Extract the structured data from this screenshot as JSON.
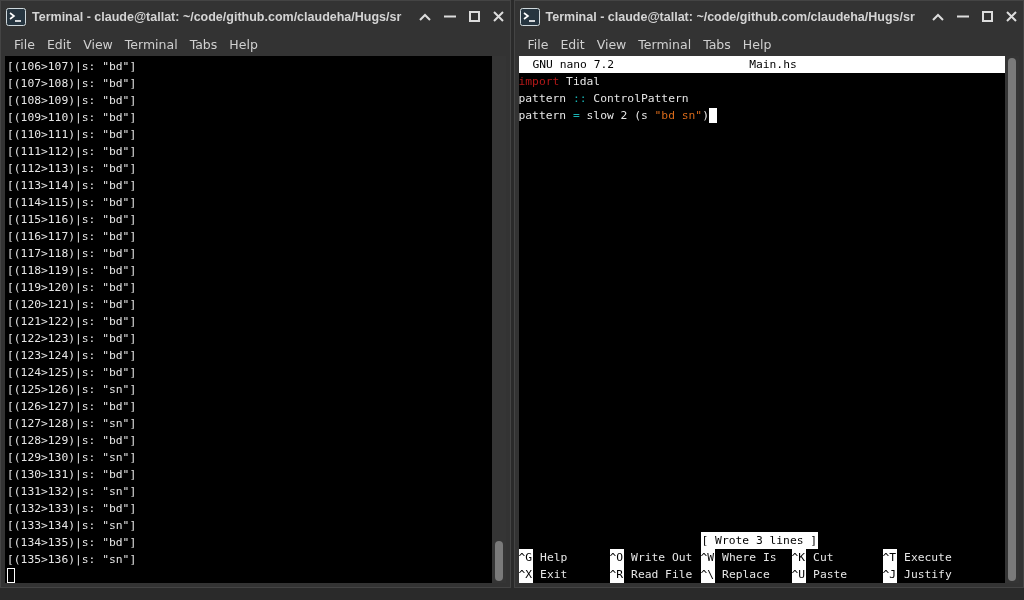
{
  "windows": [
    {
      "title": "Terminal - claude@tallat: ~/code/github.com/claudeha/Hugs/sr",
      "menu": [
        "File",
        "Edit",
        "View",
        "Terminal",
        "Tabs",
        "Help"
      ],
      "kind": "output",
      "lines": [
        "[(106>107)|s: \"bd\"]",
        "[(107>108)|s: \"bd\"]",
        "[(108>109)|s: \"bd\"]",
        "[(109>110)|s: \"bd\"]",
        "[(110>111)|s: \"bd\"]",
        "[(111>112)|s: \"bd\"]",
        "[(112>113)|s: \"bd\"]",
        "[(113>114)|s: \"bd\"]",
        "[(114>115)|s: \"bd\"]",
        "[(115>116)|s: \"bd\"]",
        "[(116>117)|s: \"bd\"]",
        "[(117>118)|s: \"bd\"]",
        "[(118>119)|s: \"bd\"]",
        "[(119>120)|s: \"bd\"]",
        "[(120>121)|s: \"bd\"]",
        "[(121>122)|s: \"bd\"]",
        "[(122>123)|s: \"bd\"]",
        "[(123>124)|s: \"bd\"]",
        "[(124>125)|s: \"bd\"]",
        "[(125>126)|s: \"sn\"]",
        "[(126>127)|s: \"bd\"]",
        "[(127>128)|s: \"sn\"]",
        "[(128>129)|s: \"bd\"]",
        "[(129>130)|s: \"sn\"]",
        "[(130>131)|s: \"bd\"]",
        "[(131>132)|s: \"sn\"]",
        "[(132>133)|s: \"bd\"]",
        "[(133>134)|s: \"sn\"]",
        "[(134>135)|s: \"bd\"]",
        "[(135>136)|s: \"sn\"]"
      ]
    },
    {
      "title": "Terminal - claude@tallat: ~/code/github.com/claudeha/Hugs/sr",
      "menu": [
        "File",
        "Edit",
        "View",
        "Terminal",
        "Tabs",
        "Help"
      ],
      "kind": "nano",
      "nano": {
        "version": "GNU nano 7.2",
        "file": "Main.hs",
        "code": [
          [
            {
              "kind": "keyword",
              "text": "import"
            },
            {
              "kind": "plain",
              "text": " Tidal"
            }
          ],
          [
            {
              "kind": "plain",
              "text": "pattern "
            },
            {
              "kind": "operator",
              "text": "::"
            },
            {
              "kind": "plain",
              "text": " ControlPattern"
            }
          ],
          [
            {
              "kind": "plain",
              "text": "pattern "
            },
            {
              "kind": "operator",
              "text": "="
            },
            {
              "kind": "plain",
              "text": " slow 2 (s "
            },
            {
              "kind": "string",
              "text": "\"bd sn\""
            },
            {
              "kind": "plain",
              "text": ")"
            }
          ]
        ],
        "status": "[ Wrote 3 lines ]",
        "shortcuts": [
          [
            {
              "key": "^G",
              "label": "Help"
            },
            {
              "key": "^O",
              "label": "Write Out"
            },
            {
              "key": "^W",
              "label": "Where Is"
            },
            {
              "key": "^K",
              "label": "Cut"
            },
            {
              "key": "^T",
              "label": "Execute"
            }
          ],
          [
            {
              "key": "^X",
              "label": "Exit"
            },
            {
              "key": "^R",
              "label": "Read File"
            },
            {
              "key": "^\\",
              "label": "Replace"
            },
            {
              "key": "^U",
              "label": "Paste"
            },
            {
              "key": "^J",
              "label": "Justify"
            }
          ]
        ]
      }
    }
  ]
}
